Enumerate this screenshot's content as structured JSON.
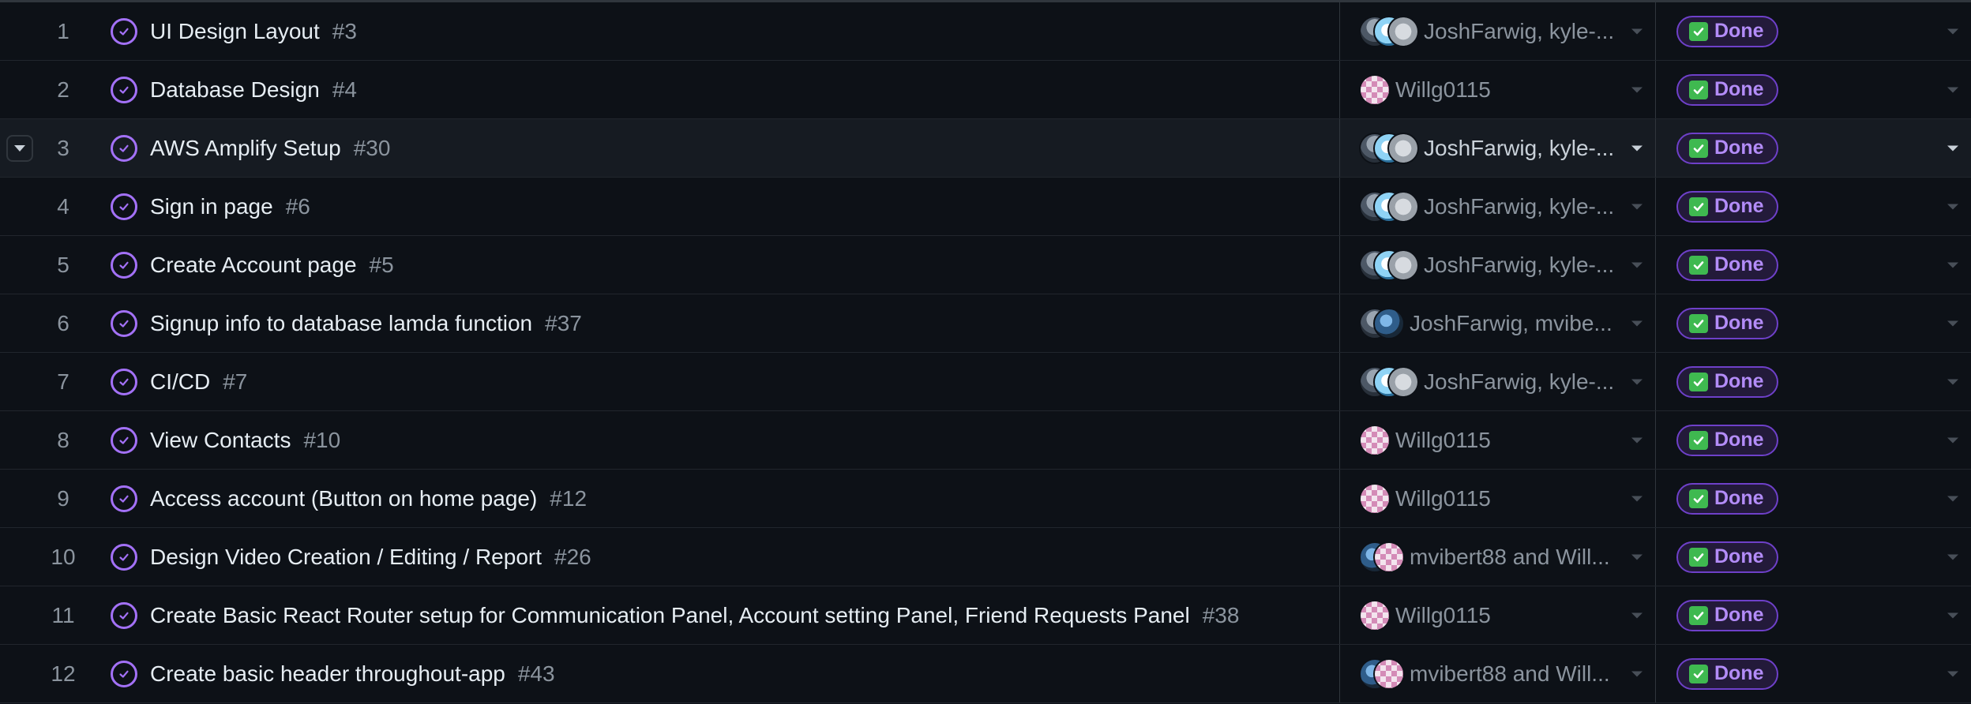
{
  "colors": {
    "background": "#0d1117",
    "row_hover": "#161b22",
    "status_accent": "#a371f7",
    "done_text": "#b38cf8",
    "done_check": "#3fb950"
  },
  "status_label": "Done",
  "rows": [
    {
      "num": "1",
      "title": "UI Design Layout",
      "issue": "#3",
      "assignees": "JoshFarwig, kyle-...",
      "avatars": [
        "av-josh",
        "av-kyle",
        "av-grey"
      ]
    },
    {
      "num": "2",
      "title": "Database Design",
      "issue": "#4",
      "assignees": "Willg0115",
      "avatars": [
        "av-will"
      ]
    },
    {
      "num": "3",
      "title": "AWS Amplify Setup",
      "issue": "#30",
      "assignees": "JoshFarwig, kyle-...",
      "avatars": [
        "av-josh",
        "av-kyle",
        "av-grey"
      ]
    },
    {
      "num": "4",
      "title": "Sign in page",
      "issue": "#6",
      "assignees": "JoshFarwig, kyle-...",
      "avatars": [
        "av-josh",
        "av-kyle",
        "av-grey"
      ]
    },
    {
      "num": "5",
      "title": "Create Account page",
      "issue": "#5",
      "assignees": "JoshFarwig, kyle-...",
      "avatars": [
        "av-josh",
        "av-kyle",
        "av-grey"
      ]
    },
    {
      "num": "6",
      "title": "Signup info to database lamda function",
      "issue": "#37",
      "assignees": "JoshFarwig, mvibe...",
      "avatars": [
        "av-josh",
        "av-mvib"
      ]
    },
    {
      "num": "7",
      "title": "CI/CD",
      "issue": "#7",
      "assignees": "JoshFarwig, kyle-...",
      "avatars": [
        "av-josh",
        "av-kyle",
        "av-grey"
      ]
    },
    {
      "num": "8",
      "title": "View Contacts",
      "issue": "#10",
      "assignees": "Willg0115",
      "avatars": [
        "av-will"
      ]
    },
    {
      "num": "9",
      "title": "Access account (Button on home page)",
      "issue": "#12",
      "assignees": "Willg0115",
      "avatars": [
        "av-will"
      ]
    },
    {
      "num": "10",
      "title": "Design Video Creation / Editing / Report",
      "issue": "#26",
      "assignees": "mvibert88 and Will...",
      "avatars": [
        "av-mvib",
        "av-will"
      ]
    },
    {
      "num": "11",
      "title": "Create Basic React Router setup for Communication Panel, Account setting Panel, Friend Requests Panel",
      "issue": "#38",
      "assignees": "Willg0115",
      "avatars": [
        "av-will"
      ]
    },
    {
      "num": "12",
      "title": "Create basic header throughout-app",
      "issue": "#43",
      "assignees": "mvibert88 and Will...",
      "avatars": [
        "av-mvib",
        "av-will"
      ]
    }
  ],
  "hovered_row": 2
}
